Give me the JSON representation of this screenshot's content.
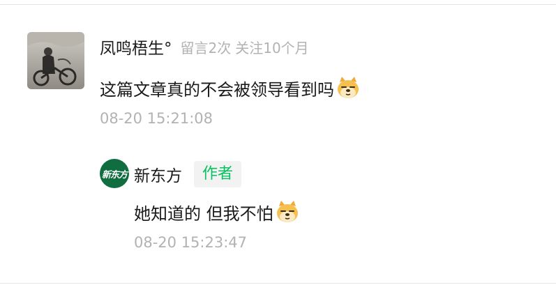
{
  "comment": {
    "nickname": "凤鸣梧生°",
    "meta_count": "留言2次",
    "meta_follow": "关注10个月",
    "text": "这篇文章真的不会被领导看到吗",
    "emoji_icon": "doge-emoji-icon",
    "time": "08-20 15:21:08"
  },
  "reply": {
    "avatar_text": "新东方",
    "name": "新东方",
    "badge": "作者",
    "text": "她知道的 但我不怕",
    "emoji_icon": "doge-emoji-icon",
    "time": "08-20 15:23:47"
  },
  "colors": {
    "author_badge_text": "#07c160",
    "author_badge_bg": "#f2f2f2",
    "reply_avatar_bg": "#106d3f",
    "meta_gray": "#b2b2b2"
  }
}
